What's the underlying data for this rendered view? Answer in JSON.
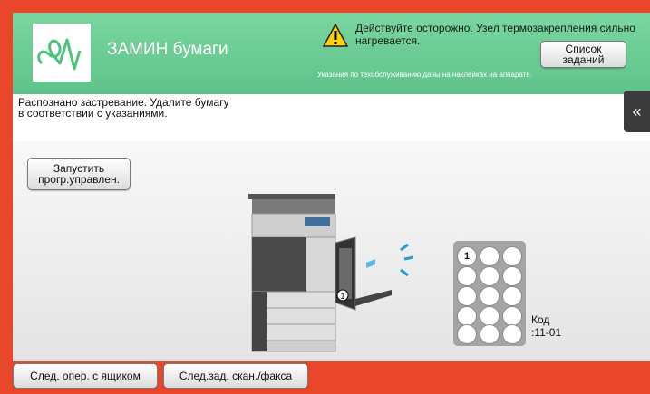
{
  "header": {
    "title": "ЗАМИН бумаги",
    "warning_text": "Действуйте осторожно. Узел термозакрепления сильно нагревается.",
    "maintenance_note": "Указания по техобслуживанию даны на наклейках на аппарате.",
    "jobs_button": {
      "line1": "Список",
      "line2": "заданий"
    }
  },
  "message": {
    "line1": "Распознано застревание. Удалите бумагу",
    "line2": "в соответствии с указаниями."
  },
  "start_button": {
    "line1": "Запустить",
    "line2": "прогр.управлен."
  },
  "diagram": {
    "callout_number": "1",
    "keypad_first": "1",
    "code_label": "Код",
    "code_value": ":11-01"
  },
  "bottom": {
    "tray_button": "След. опер. с ящиком",
    "scan_fax_button": "След.зад. скан./факса"
  },
  "colors": {
    "header": "#6fcf97",
    "frame": "#e8472b",
    "side_tab": "#3a3a3a"
  },
  "icons": {
    "logo": "pulse-logo-icon",
    "warning": "warning-triangle-icon",
    "side_tab": "double-chevron-left-icon"
  }
}
